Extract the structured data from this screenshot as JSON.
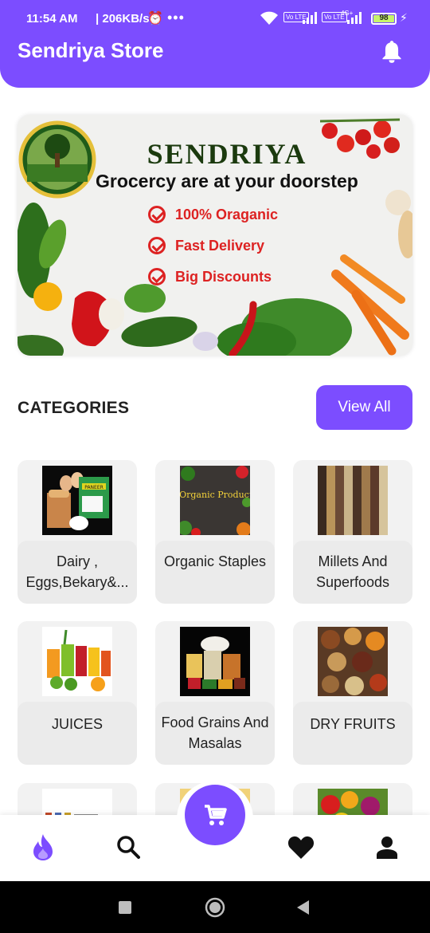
{
  "status_bar": {
    "time": "11:54 AM",
    "speed": "| 206KB/s",
    "tag1": "Vo LTE",
    "tag2": "Vo LTE",
    "tag3": "4G+",
    "battery": "98"
  },
  "app_bar": {
    "title": "Sendriya Store",
    "icon": "bell-icon"
  },
  "banner": {
    "brand": "SENDRIYA",
    "tagline": "Grocercy are at your doorstep",
    "features": [
      "100% Oraganic",
      "Fast Delivery",
      "Big Discounts"
    ]
  },
  "categories": {
    "title": "CATEGORIES",
    "view_all": "View All",
    "items": [
      {
        "label": "Dairy , Eggs,Bekary&...",
        "thumb_text": "PANEER"
      },
      {
        "label": "Organic Staples",
        "thumb_text": "Organic Products"
      },
      {
        "label": "Millets And Superfoods",
        "thumb_text": ""
      },
      {
        "label": "JUICES",
        "thumb_text": ""
      },
      {
        "label": "Food Grains And Masalas",
        "thumb_text": ""
      },
      {
        "label": "DRY FRUITS",
        "thumb_text": ""
      }
    ]
  },
  "bottom_nav": {
    "items": [
      "flame-icon",
      "search-icon",
      "cart-icon",
      "heart-icon",
      "person-icon"
    ],
    "active": "flame-icon"
  },
  "system_nav": [
    "square-icon",
    "circle-icon",
    "back-triangle-icon"
  ],
  "colors": {
    "accent": "#7c4dff",
    "card_bg": "#f2f2f2",
    "feature_red": "#dd2222"
  }
}
